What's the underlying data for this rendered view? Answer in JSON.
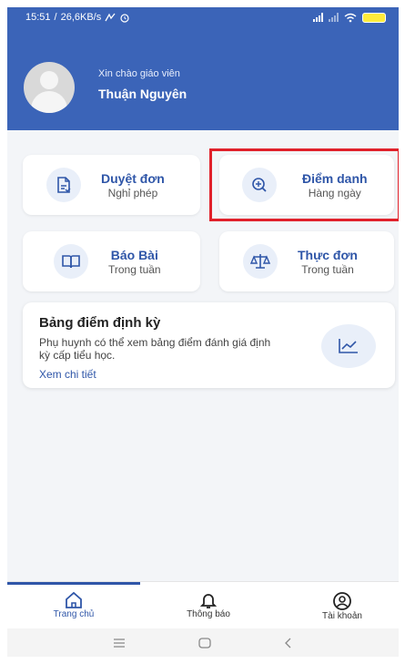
{
  "status_bar": {
    "time": "15:51",
    "speed": "26,6KB/s",
    "battery": ""
  },
  "header": {
    "greeting": "Xin chào giáo viên",
    "user_name": "Thuận Nguyên"
  },
  "cards": [
    {
      "title": "Duyệt đơn",
      "subtitle": "Nghỉ phép",
      "icon": "document-check-icon"
    },
    {
      "title": "Điểm danh",
      "subtitle": "Hàng ngày",
      "icon": "zoom-plus-icon"
    },
    {
      "title": "Báo Bài",
      "subtitle": "Trong tuần",
      "icon": "book-icon"
    },
    {
      "title": "Thực đơn",
      "subtitle": "Trong tuần",
      "icon": "scale-icon"
    }
  ],
  "report_card": {
    "title": "Bảng điểm định kỳ",
    "description": "Phụ huynh có thể xem bảng điểm đánh giá định kỳ cấp tiểu học.",
    "link": "Xem chi tiết",
    "icon": "chart-line-icon"
  },
  "bottom_nav": [
    {
      "label": "Trang chủ",
      "icon": "home-icon",
      "active": true
    },
    {
      "label": "Thông báo",
      "icon": "bell-icon",
      "active": false
    },
    {
      "label": "Tài khoản",
      "icon": "account-icon",
      "active": false
    }
  ],
  "colors": {
    "header_bg": "#3b64b8",
    "accent": "#2f56a8",
    "highlight_border": "#e0212b",
    "page_bg": "#f3f5f8"
  }
}
